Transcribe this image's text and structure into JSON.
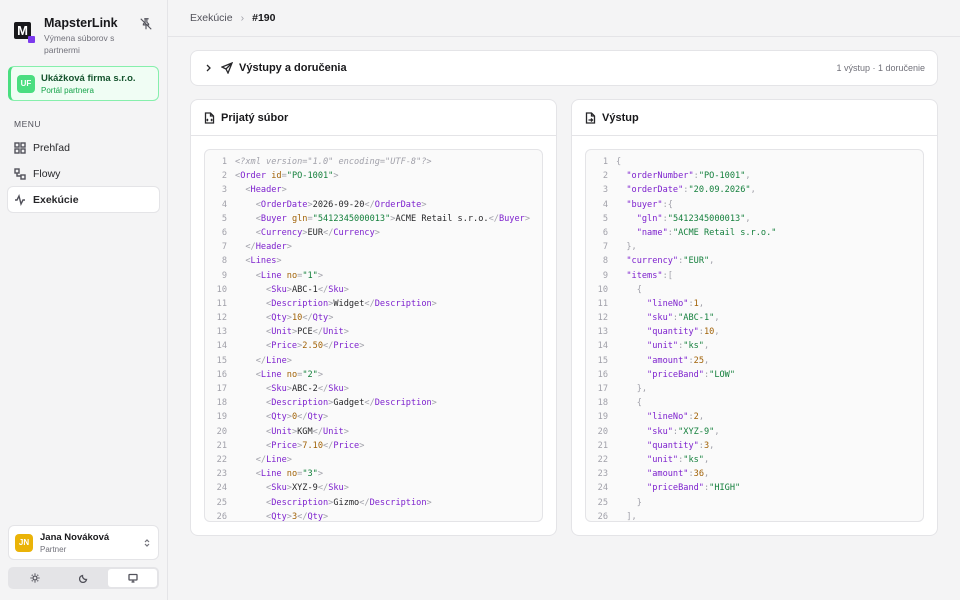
{
  "sidebar": {
    "brand_name": "MapsterLink",
    "brand_sub": "Výmena súborov s partnermi",
    "brand_logo_letter": "M",
    "tenant": {
      "initials": "UF",
      "name": "Ukážková firma s.r.o.",
      "sub": "Portál partnera"
    },
    "menu_label": "MENU",
    "items": [
      {
        "label": "Prehľad",
        "icon": "grid-icon",
        "active": false
      },
      {
        "label": "Flowy",
        "icon": "workflow-icon",
        "active": false
      },
      {
        "label": "Exekúcie",
        "icon": "activity-icon",
        "active": true
      }
    ],
    "user": {
      "initials": "JN",
      "name": "Jana Nováková",
      "role": "Partner"
    },
    "theme_options": [
      {
        "icon": "sun-icon",
        "active": false
      },
      {
        "icon": "moon-icon",
        "active": false
      },
      {
        "icon": "monitor-icon",
        "active": true
      }
    ]
  },
  "breadcrumb": {
    "parent": "Exekúcie",
    "current": "#190"
  },
  "outputs": {
    "title": "Výstupy a doručenia",
    "meta": "1 výstup · 1 doručenie"
  },
  "panels": {
    "input_title": "Prijatý súbor",
    "output_title": "Výstup"
  },
  "xml_lines": [
    [
      [
        "pi",
        "<?xml version=\"1.0\" encoding=\"UTF-8\"?>"
      ]
    ],
    [
      [
        "p",
        "<"
      ],
      [
        "tag",
        "Order"
      ],
      [
        "attr",
        " id"
      ],
      [
        "p",
        "="
      ],
      [
        "str",
        "\"PO-1001\""
      ],
      [
        "p",
        ">"
      ]
    ],
    [
      [
        "src",
        "  "
      ],
      [
        "p",
        "<"
      ],
      [
        "tag",
        "Header"
      ],
      [
        "p",
        ">"
      ]
    ],
    [
      [
        "src",
        "    "
      ],
      [
        "p",
        "<"
      ],
      [
        "tag",
        "OrderDate"
      ],
      [
        "p",
        ">"
      ],
      [
        "src",
        "2026-09-20"
      ],
      [
        "p",
        "</"
      ],
      [
        "tag",
        "OrderDate"
      ],
      [
        "p",
        ">"
      ]
    ],
    [
      [
        "src",
        "    "
      ],
      [
        "p",
        "<"
      ],
      [
        "tag",
        "Buyer"
      ],
      [
        "attr",
        " gln"
      ],
      [
        "p",
        "="
      ],
      [
        "str",
        "\"5412345000013\""
      ],
      [
        "p",
        ">"
      ],
      [
        "src",
        "ACME Retail s.r.o."
      ],
      [
        "p",
        "</"
      ],
      [
        "tag",
        "Buyer"
      ],
      [
        "p",
        ">"
      ]
    ],
    [
      [
        "src",
        "    "
      ],
      [
        "p",
        "<"
      ],
      [
        "tag",
        "Currency"
      ],
      [
        "p",
        ">"
      ],
      [
        "src",
        "EUR"
      ],
      [
        "p",
        "</"
      ],
      [
        "tag",
        "Currency"
      ],
      [
        "p",
        ">"
      ]
    ],
    [
      [
        "src",
        "  "
      ],
      [
        "p",
        "</"
      ],
      [
        "tag",
        "Header"
      ],
      [
        "p",
        ">"
      ]
    ],
    [
      [
        "src",
        "  "
      ],
      [
        "p",
        "<"
      ],
      [
        "tag",
        "Lines"
      ],
      [
        "p",
        ">"
      ]
    ],
    [
      [
        "src",
        "    "
      ],
      [
        "p",
        "<"
      ],
      [
        "tag",
        "Line"
      ],
      [
        "attr",
        " no"
      ],
      [
        "p",
        "="
      ],
      [
        "str",
        "\"1\""
      ],
      [
        "p",
        ">"
      ]
    ],
    [
      [
        "src",
        "      "
      ],
      [
        "p",
        "<"
      ],
      [
        "tag",
        "Sku"
      ],
      [
        "p",
        ">"
      ],
      [
        "src",
        "ABC-1"
      ],
      [
        "p",
        "</"
      ],
      [
        "tag",
        "Sku"
      ],
      [
        "p",
        ">"
      ]
    ],
    [
      [
        "src",
        "      "
      ],
      [
        "p",
        "<"
      ],
      [
        "tag",
        "Description"
      ],
      [
        "p",
        ">"
      ],
      [
        "src",
        "Widget"
      ],
      [
        "p",
        "</"
      ],
      [
        "tag",
        "Description"
      ],
      [
        "p",
        ">"
      ]
    ],
    [
      [
        "src",
        "      "
      ],
      [
        "p",
        "<"
      ],
      [
        "tag",
        "Qty"
      ],
      [
        "p",
        ">"
      ],
      [
        "num",
        "10"
      ],
      [
        "p",
        "</"
      ],
      [
        "tag",
        "Qty"
      ],
      [
        "p",
        ">"
      ]
    ],
    [
      [
        "src",
        "      "
      ],
      [
        "p",
        "<"
      ],
      [
        "tag",
        "Unit"
      ],
      [
        "p",
        ">"
      ],
      [
        "src",
        "PCE"
      ],
      [
        "p",
        "</"
      ],
      [
        "tag",
        "Unit"
      ],
      [
        "p",
        ">"
      ]
    ],
    [
      [
        "src",
        "      "
      ],
      [
        "p",
        "<"
      ],
      [
        "tag",
        "Price"
      ],
      [
        "p",
        ">"
      ],
      [
        "num",
        "2.50"
      ],
      [
        "p",
        "</"
      ],
      [
        "tag",
        "Price"
      ],
      [
        "p",
        ">"
      ]
    ],
    [
      [
        "src",
        "    "
      ],
      [
        "p",
        "</"
      ],
      [
        "tag",
        "Line"
      ],
      [
        "p",
        ">"
      ]
    ],
    [
      [
        "src",
        "    "
      ],
      [
        "p",
        "<"
      ],
      [
        "tag",
        "Line"
      ],
      [
        "attr",
        " no"
      ],
      [
        "p",
        "="
      ],
      [
        "str",
        "\"2\""
      ],
      [
        "p",
        ">"
      ]
    ],
    [
      [
        "src",
        "      "
      ],
      [
        "p",
        "<"
      ],
      [
        "tag",
        "Sku"
      ],
      [
        "p",
        ">"
      ],
      [
        "src",
        "ABC-2"
      ],
      [
        "p",
        "</"
      ],
      [
        "tag",
        "Sku"
      ],
      [
        "p",
        ">"
      ]
    ],
    [
      [
        "src",
        "      "
      ],
      [
        "p",
        "<"
      ],
      [
        "tag",
        "Description"
      ],
      [
        "p",
        ">"
      ],
      [
        "src",
        "Gadget"
      ],
      [
        "p",
        "</"
      ],
      [
        "tag",
        "Description"
      ],
      [
        "p",
        ">"
      ]
    ],
    [
      [
        "src",
        "      "
      ],
      [
        "p",
        "<"
      ],
      [
        "tag",
        "Qty"
      ],
      [
        "p",
        ">"
      ],
      [
        "num",
        "0"
      ],
      [
        "p",
        "</"
      ],
      [
        "tag",
        "Qty"
      ],
      [
        "p",
        ">"
      ]
    ],
    [
      [
        "src",
        "      "
      ],
      [
        "p",
        "<"
      ],
      [
        "tag",
        "Unit"
      ],
      [
        "p",
        ">"
      ],
      [
        "src",
        "KGM"
      ],
      [
        "p",
        "</"
      ],
      [
        "tag",
        "Unit"
      ],
      [
        "p",
        ">"
      ]
    ],
    [
      [
        "src",
        "      "
      ],
      [
        "p",
        "<"
      ],
      [
        "tag",
        "Price"
      ],
      [
        "p",
        ">"
      ],
      [
        "num",
        "7.10"
      ],
      [
        "p",
        "</"
      ],
      [
        "tag",
        "Price"
      ],
      [
        "p",
        ">"
      ]
    ],
    [
      [
        "src",
        "    "
      ],
      [
        "p",
        "</"
      ],
      [
        "tag",
        "Line"
      ],
      [
        "p",
        ">"
      ]
    ],
    [
      [
        "src",
        "    "
      ],
      [
        "p",
        "<"
      ],
      [
        "tag",
        "Line"
      ],
      [
        "attr",
        " no"
      ],
      [
        "p",
        "="
      ],
      [
        "str",
        "\"3\""
      ],
      [
        "p",
        ">"
      ]
    ],
    [
      [
        "src",
        "      "
      ],
      [
        "p",
        "<"
      ],
      [
        "tag",
        "Sku"
      ],
      [
        "p",
        ">"
      ],
      [
        "src",
        "XYZ-9"
      ],
      [
        "p",
        "</"
      ],
      [
        "tag",
        "Sku"
      ],
      [
        "p",
        ">"
      ]
    ],
    [
      [
        "src",
        "      "
      ],
      [
        "p",
        "<"
      ],
      [
        "tag",
        "Description"
      ],
      [
        "p",
        ">"
      ],
      [
        "src",
        "Gizmo"
      ],
      [
        "p",
        "</"
      ],
      [
        "tag",
        "Description"
      ],
      [
        "p",
        ">"
      ]
    ],
    [
      [
        "src",
        "      "
      ],
      [
        "p",
        "<"
      ],
      [
        "tag",
        "Qty"
      ],
      [
        "p",
        ">"
      ],
      [
        "num",
        "3"
      ],
      [
        "p",
        "</"
      ],
      [
        "tag",
        "Qty"
      ],
      [
        "p",
        ">"
      ]
    ]
  ],
  "json_lines": [
    [
      [
        "p",
        "{"
      ]
    ],
    [
      [
        "src",
        "  "
      ],
      [
        "key",
        "\"orderNumber\""
      ],
      [
        "p",
        ":"
      ],
      [
        "str",
        "\"PO-1001\""
      ],
      [
        "p",
        ","
      ]
    ],
    [
      [
        "src",
        "  "
      ],
      [
        "key",
        "\"orderDate\""
      ],
      [
        "p",
        ":"
      ],
      [
        "str",
        "\"20.09.2026\""
      ],
      [
        "p",
        ","
      ]
    ],
    [
      [
        "src",
        "  "
      ],
      [
        "key",
        "\"buyer\""
      ],
      [
        "p",
        ":"
      ],
      [
        "p",
        "{"
      ]
    ],
    [
      [
        "src",
        "    "
      ],
      [
        "key",
        "\"gln\""
      ],
      [
        "p",
        ":"
      ],
      [
        "str",
        "\"5412345000013\""
      ],
      [
        "p",
        ","
      ]
    ],
    [
      [
        "src",
        "    "
      ],
      [
        "key",
        "\"name\""
      ],
      [
        "p",
        ":"
      ],
      [
        "str",
        "\"ACME Retail s.r.o.\""
      ]
    ],
    [
      [
        "src",
        "  "
      ],
      [
        "p",
        "},"
      ]
    ],
    [
      [
        "src",
        "  "
      ],
      [
        "key",
        "\"currency\""
      ],
      [
        "p",
        ":"
      ],
      [
        "str",
        "\"EUR\""
      ],
      [
        "p",
        ","
      ]
    ],
    [
      [
        "src",
        "  "
      ],
      [
        "key",
        "\"items\""
      ],
      [
        "p",
        ":"
      ],
      [
        "p",
        "["
      ]
    ],
    [
      [
        "src",
        "    "
      ],
      [
        "p",
        "{"
      ]
    ],
    [
      [
        "src",
        "      "
      ],
      [
        "key",
        "\"lineNo\""
      ],
      [
        "p",
        ":"
      ],
      [
        "num",
        "1"
      ],
      [
        "p",
        ","
      ]
    ],
    [
      [
        "src",
        "      "
      ],
      [
        "key",
        "\"sku\""
      ],
      [
        "p",
        ":"
      ],
      [
        "str",
        "\"ABC-1\""
      ],
      [
        "p",
        ","
      ]
    ],
    [
      [
        "src",
        "      "
      ],
      [
        "key",
        "\"quantity\""
      ],
      [
        "p",
        ":"
      ],
      [
        "num",
        "10"
      ],
      [
        "p",
        ","
      ]
    ],
    [
      [
        "src",
        "      "
      ],
      [
        "key",
        "\"unit\""
      ],
      [
        "p",
        ":"
      ],
      [
        "str",
        "\"ks\""
      ],
      [
        "p",
        ","
      ]
    ],
    [
      [
        "src",
        "      "
      ],
      [
        "key",
        "\"amount\""
      ],
      [
        "p",
        ":"
      ],
      [
        "num",
        "25"
      ],
      [
        "p",
        ","
      ]
    ],
    [
      [
        "src",
        "      "
      ],
      [
        "key",
        "\"priceBand\""
      ],
      [
        "p",
        ":"
      ],
      [
        "str",
        "\"LOW\""
      ]
    ],
    [
      [
        "src",
        "    "
      ],
      [
        "p",
        "},"
      ]
    ],
    [
      [
        "src",
        "    "
      ],
      [
        "p",
        "{"
      ]
    ],
    [
      [
        "src",
        "      "
      ],
      [
        "key",
        "\"lineNo\""
      ],
      [
        "p",
        ":"
      ],
      [
        "num",
        "2"
      ],
      [
        "p",
        ","
      ]
    ],
    [
      [
        "src",
        "      "
      ],
      [
        "key",
        "\"sku\""
      ],
      [
        "p",
        ":"
      ],
      [
        "str",
        "\"XYZ-9\""
      ],
      [
        "p",
        ","
      ]
    ],
    [
      [
        "src",
        "      "
      ],
      [
        "key",
        "\"quantity\""
      ],
      [
        "p",
        ":"
      ],
      [
        "num",
        "3"
      ],
      [
        "p",
        ","
      ]
    ],
    [
      [
        "src",
        "      "
      ],
      [
        "key",
        "\"unit\""
      ],
      [
        "p",
        ":"
      ],
      [
        "str",
        "\"ks\""
      ],
      [
        "p",
        ","
      ]
    ],
    [
      [
        "src",
        "      "
      ],
      [
        "key",
        "\"amount\""
      ],
      [
        "p",
        ":"
      ],
      [
        "num",
        "36"
      ],
      [
        "p",
        ","
      ]
    ],
    [
      [
        "src",
        "      "
      ],
      [
        "key",
        "\"priceBand\""
      ],
      [
        "p",
        ":"
      ],
      [
        "str",
        "\"HIGH\""
      ]
    ],
    [
      [
        "src",
        "    "
      ],
      [
        "p",
        "}"
      ]
    ],
    [
      [
        "src",
        "  "
      ],
      [
        "p",
        "],"
      ]
    ]
  ]
}
